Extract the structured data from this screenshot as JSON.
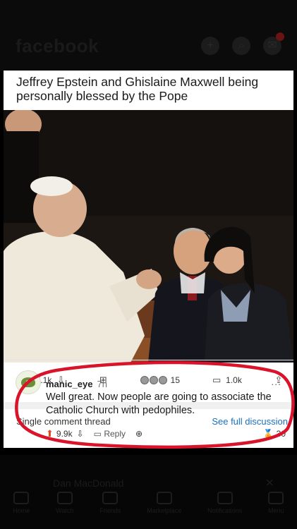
{
  "fb": {
    "logo": "facebook",
    "icons": [
      "plus-icon",
      "search-icon",
      "messenger-icon"
    ]
  },
  "post": {
    "title": "Jeffrey Epstein and Ghislaine Maxwell being personally blessed by the Pope",
    "upvotes": "17.1k",
    "awards_count": "15",
    "comments": "1.0k"
  },
  "thread": {
    "label": "Single comment thread",
    "link": "See full discussion"
  },
  "comment": {
    "user": "manic_eye",
    "time": "7h",
    "more": "...",
    "text": "Well great. Now people are going to associate the Catholic Church with pedophiles.",
    "score": "9.9k",
    "reply": "Reply",
    "award_count": "30"
  },
  "bottom": {
    "name": "Dan MacDonald",
    "nav": [
      "Home",
      "Watch",
      "Friends",
      "Marketplace",
      "Notifications",
      "Menu"
    ]
  },
  "colors": {
    "annotation": "#d8132a",
    "link": "#1a6ec1",
    "upvote": "#e0491d"
  }
}
